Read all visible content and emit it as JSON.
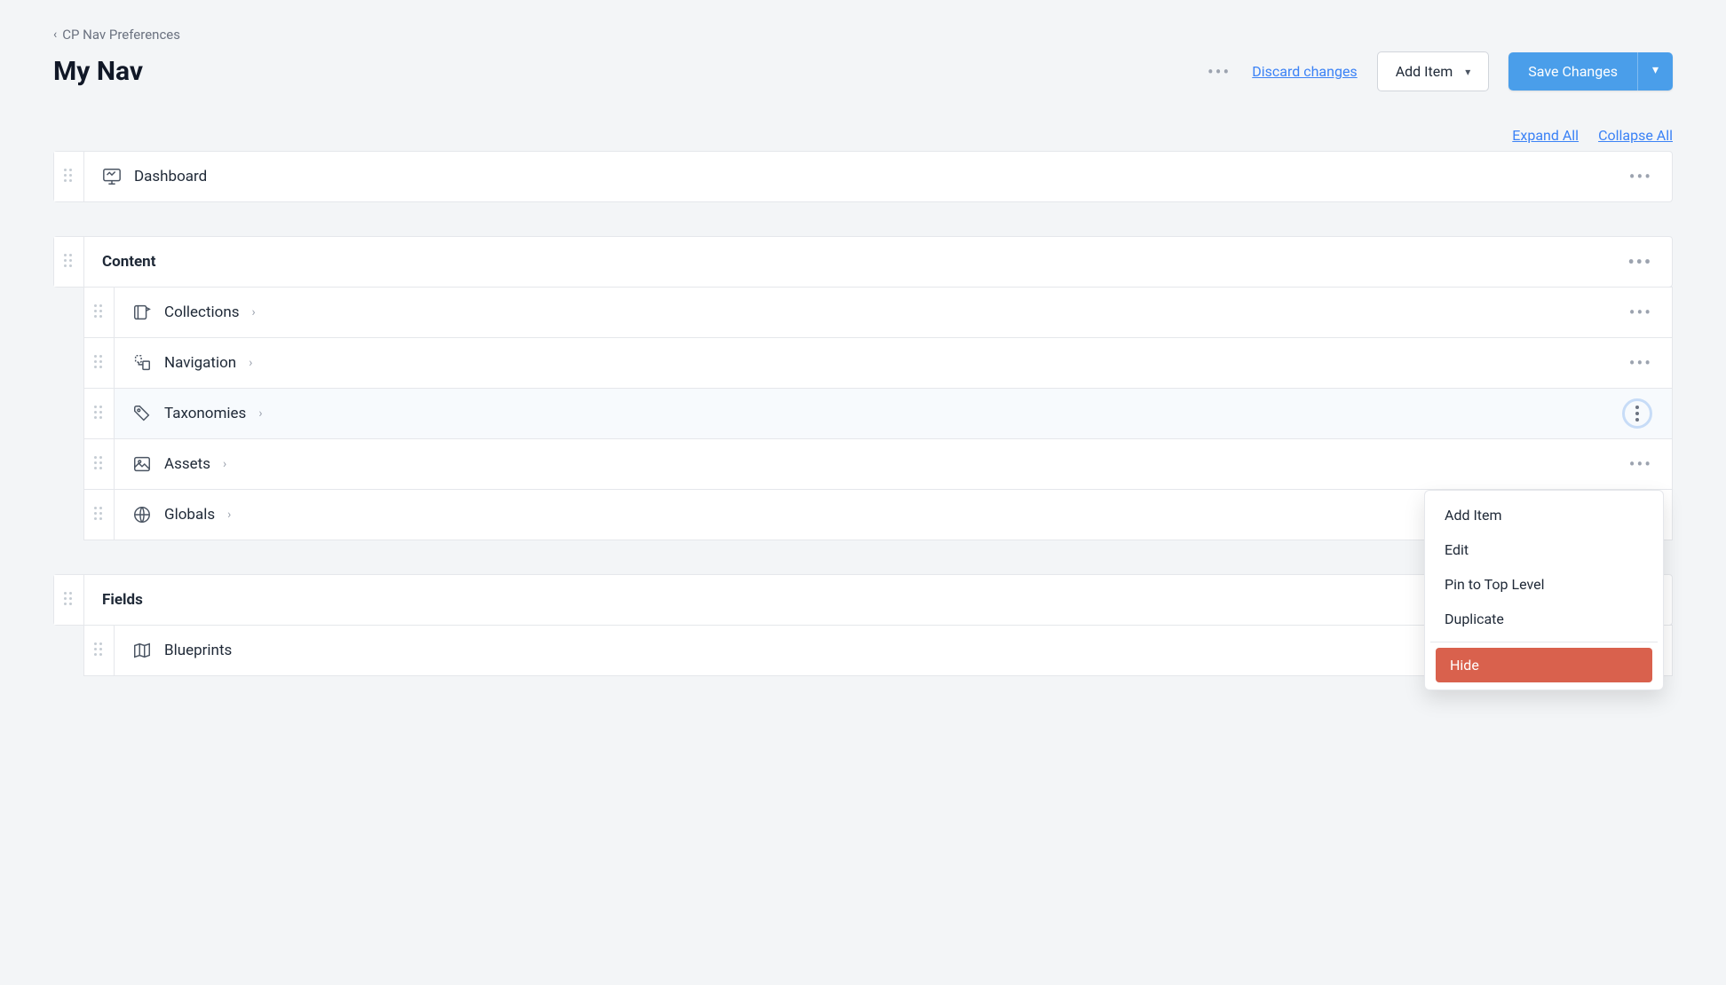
{
  "breadcrumb": {
    "label": "CP Nav Preferences"
  },
  "page_title": "My Nav",
  "header": {
    "discard_label": "Discard changes",
    "add_item_label": "Add Item",
    "save_label": "Save Changes"
  },
  "toolbar": {
    "expand_all": "Expand All",
    "collapse_all": "Collapse All"
  },
  "top_items": [
    {
      "label": "Dashboard",
      "icon": "chart-monitor"
    }
  ],
  "sections": [
    {
      "title": "Content",
      "items": [
        {
          "label": "Collections",
          "icon": "collections"
        },
        {
          "label": "Navigation",
          "icon": "navigation"
        },
        {
          "label": "Taxonomies",
          "icon": "tag",
          "active": true
        },
        {
          "label": "Assets",
          "icon": "image"
        },
        {
          "label": "Globals",
          "icon": "globe"
        }
      ]
    },
    {
      "title": "Fields",
      "items": [
        {
          "label": "Blueprints",
          "icon": "map"
        }
      ]
    }
  ],
  "context_menu": {
    "items": [
      "Add Item",
      "Edit",
      "Pin to Top Level",
      "Duplicate"
    ],
    "danger_item": "Hide"
  }
}
